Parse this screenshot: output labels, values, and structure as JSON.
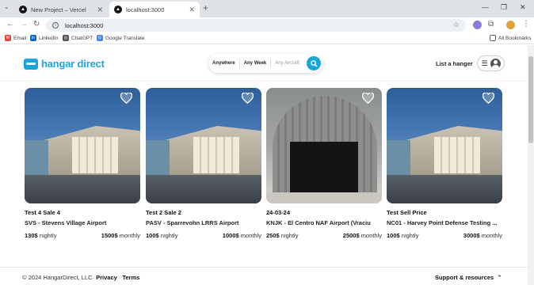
{
  "browser": {
    "tabs": [
      {
        "title": "New Project – Vercel",
        "active": false
      },
      {
        "title": "localhost:3000",
        "active": true
      }
    ],
    "new_tab": "+",
    "url": "localhost:3000",
    "bookmarks": [
      {
        "label": "Email",
        "icon": "gmail-icon",
        "color": "#ea4335"
      },
      {
        "label": "LinkedIn",
        "icon": "linkedin-icon",
        "color": "#0a66c2"
      },
      {
        "label": "ChatGPT",
        "icon": "chatgpt-icon",
        "color": "#555555"
      },
      {
        "label": "Google Translate",
        "icon": "translate-icon",
        "color": "#4285f4"
      }
    ],
    "all_bookmarks": "All Bookmarks"
  },
  "header": {
    "brand": "hangar direct",
    "search": {
      "where": "Anywhere",
      "when": "Any Week",
      "aircraft_placeholder": "Any Aircraft"
    },
    "list_link": "List a hanger"
  },
  "listings": [
    {
      "name": "Test 4 Sale 4",
      "airport": "SVS - Stevens Village Airport",
      "nightly_price": "130$",
      "nightly_label": "nightly",
      "monthly_price": "1500$",
      "monthly_label": "monthly",
      "image": "modern"
    },
    {
      "name": "Test 2 Sale 2",
      "airport": "PASV - Sparrevohn LRRS Airport",
      "nightly_price": "100$",
      "nightly_label": "nightly",
      "monthly_price": "1000$",
      "monthly_label": "monthly",
      "image": "modern"
    },
    {
      "name": "24-03-24",
      "airport": "KNJK - El Centro NAF Airport (Vraciu",
      "nightly_price": "250$",
      "nightly_label": "nightly",
      "monthly_price": "2500$",
      "monthly_label": "monthly",
      "image": "arch"
    },
    {
      "name": "Test Sell Price",
      "airport": "NC01 - Harvey Point Defense Testing ...",
      "nightly_price": "100$",
      "nightly_label": "nightly",
      "monthly_price": "3000$",
      "monthly_label": "monthly",
      "image": "modern"
    }
  ],
  "footer": {
    "copyright": "© 2024 HangarDirect, LLC·",
    "privacy": "Privacy",
    "dot": "·",
    "terms": "Terms",
    "support": "Support & resources"
  },
  "colors": {
    "accent": "#1ba6d9"
  }
}
